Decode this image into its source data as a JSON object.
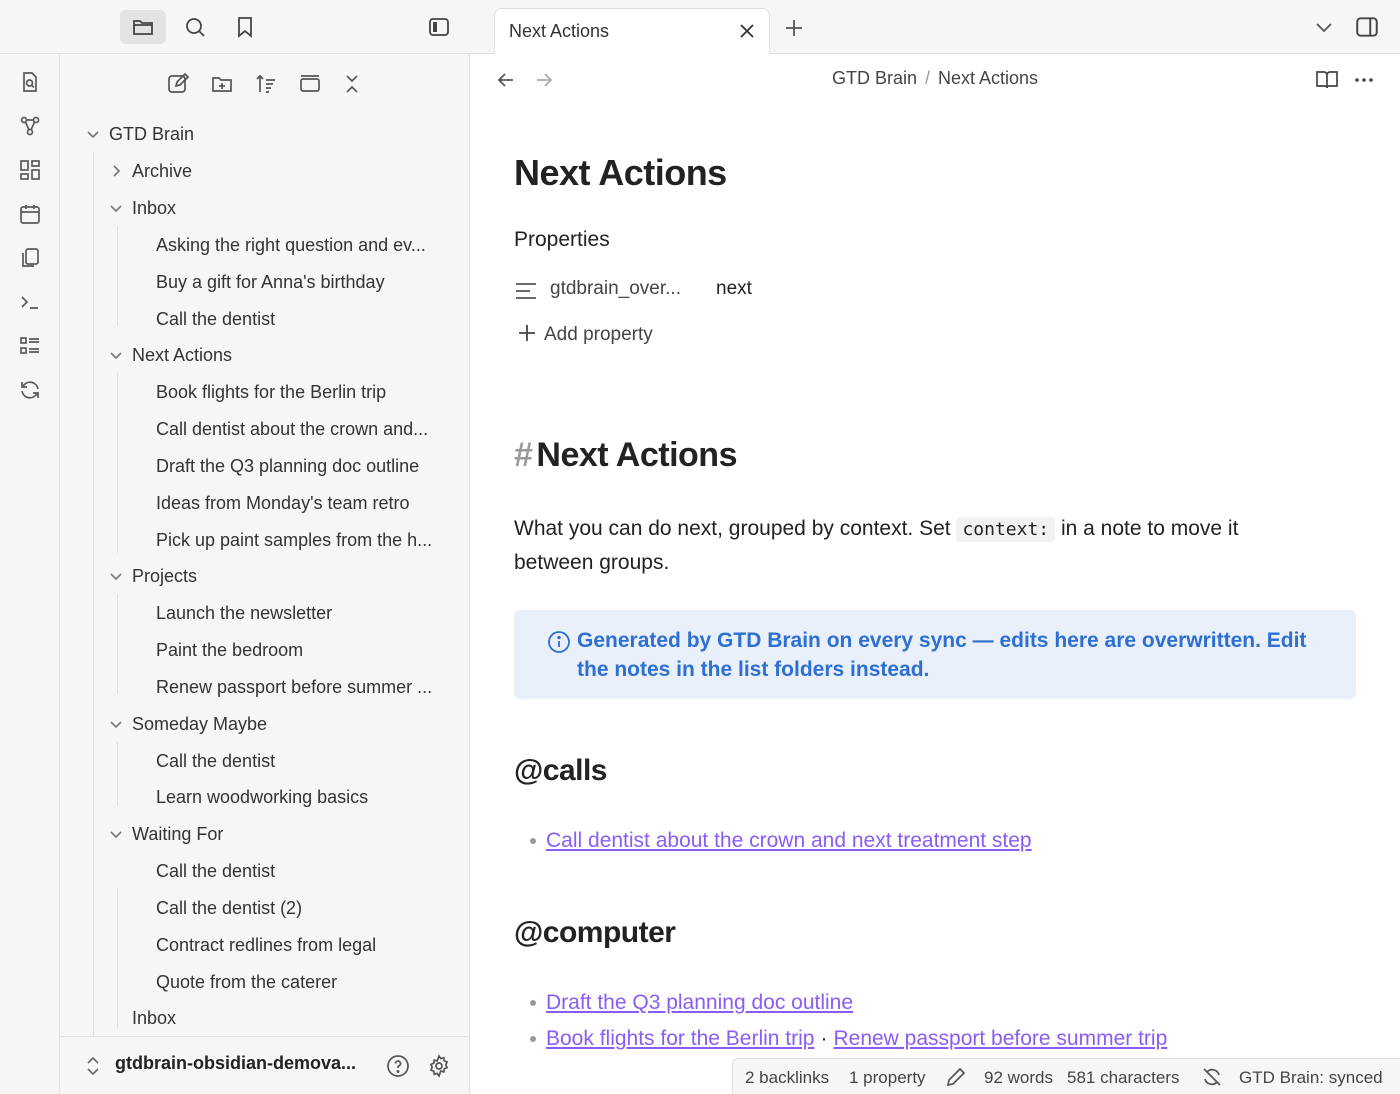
{
  "tab": {
    "title": "Next Actions"
  },
  "breadcrumb": {
    "vault": "GTD Brain",
    "separator": "/",
    "note": "Next Actions"
  },
  "tree": {
    "root": "GTD Brain",
    "rows": [
      "Archive",
      "Inbox",
      "Asking the right question and ev...",
      "Buy a gift for Anna's birthday",
      "Call the dentist",
      "Next Actions",
      "Book flights for the Berlin trip",
      "Call dentist about the crown and...",
      "Draft the Q3 planning doc outline",
      "Ideas from Monday's team retro",
      "Pick up paint samples from the h...",
      "Projects",
      "Launch the newsletter",
      "Paint the bedroom",
      "Renew passport before summer ...",
      "Someday Maybe",
      "Call the dentist",
      "Learn woodworking basics",
      "Waiting For",
      "Call the dentist",
      "Call the dentist (2)",
      "Contract redlines from legal",
      "Quote from the caterer",
      "Inbox"
    ]
  },
  "vault": {
    "name": "gtdbrain-obsidian-demova..."
  },
  "note": {
    "title": "Next Actions",
    "properties_label": "Properties",
    "property_key": "gtdbrain_over...",
    "property_value": "next",
    "add_property": "Add property",
    "heading_hash": "#",
    "heading": "Next Actions",
    "intro_before": "What you can do next, grouped by context. Set ",
    "intro_code": "context:",
    "intro_after": " in a note to move it between groups.",
    "callout": "Generated by GTD Brain on every sync — edits here are overwritten. Edit the notes in the list folders instead.",
    "section_calls": "@calls",
    "calls_link": "Call dentist about the crown and next treatment step",
    "section_computer": "@computer",
    "computer_link1": "Draft the Q3 planning doc outline",
    "computer_link2": "Book flights for the Berlin trip",
    "computer_mid": "·",
    "computer_link3": "Renew passport before summer trip"
  },
  "status": {
    "backlinks": "2 backlinks",
    "properties": "1 property",
    "words": "92 words",
    "characters": "581 characters",
    "sync": "GTD Brain: synced"
  }
}
